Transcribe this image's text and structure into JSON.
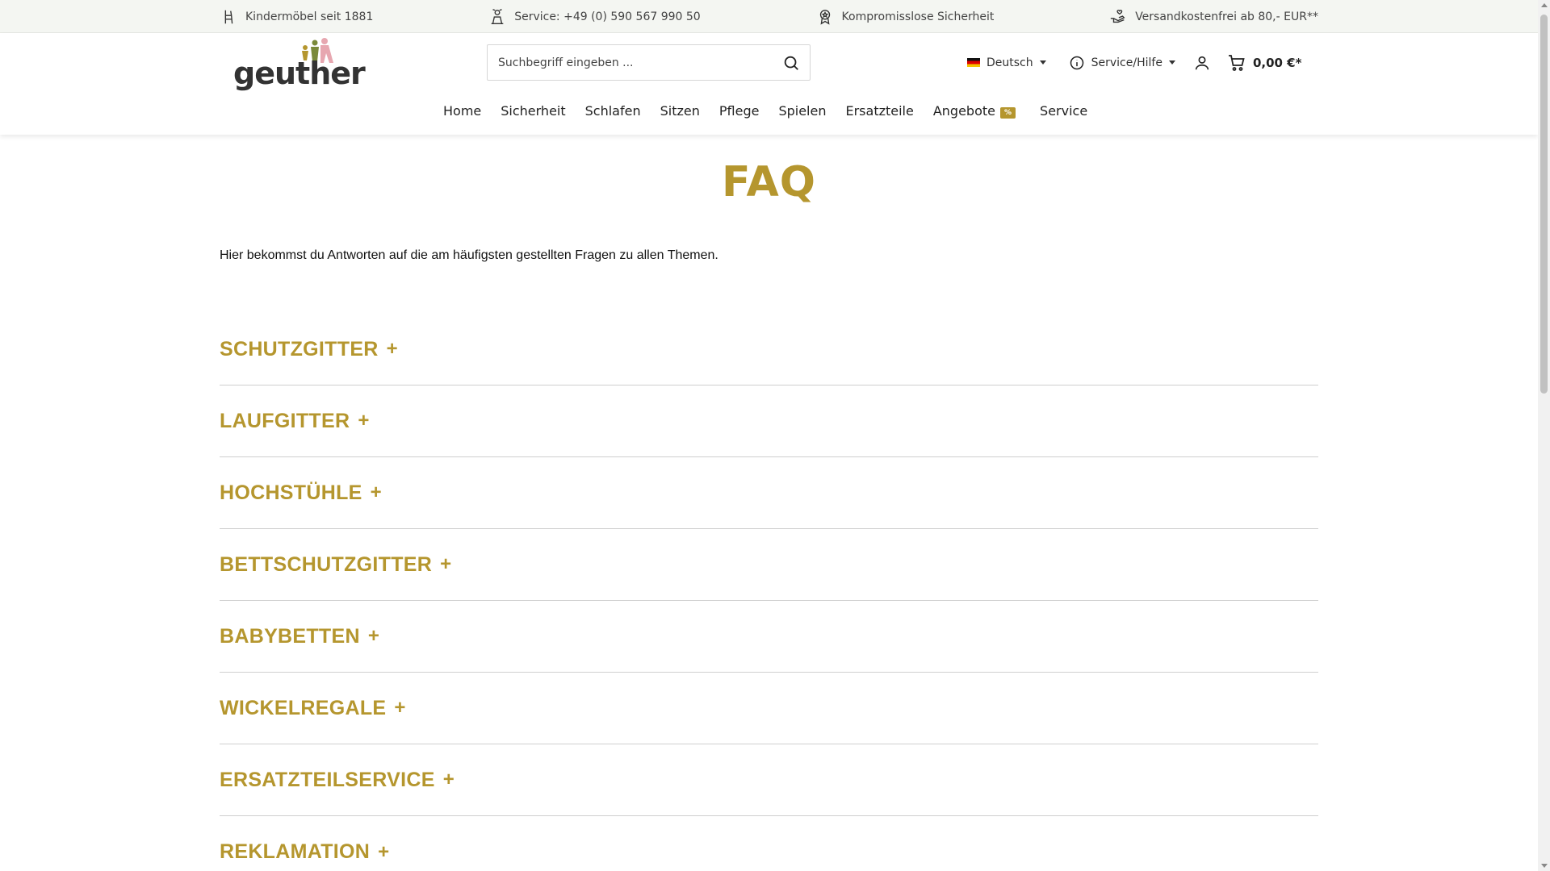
{
  "topbar": {
    "usps": [
      {
        "icon": "highchair-icon",
        "text": "Kindermöbel seit 1881"
      },
      {
        "icon": "service-person-icon",
        "text": "Service: +49 (0) 590 567 990 50"
      },
      {
        "icon": "award-icon",
        "text": "Kompromisslose Sicherheit"
      },
      {
        "icon": "hand-heart-icon",
        "text": "Versandkostenfrei ab 80,- EUR**"
      }
    ]
  },
  "header": {
    "logo_text": "geuther",
    "search_placeholder": "Suchbegriff eingeben ...",
    "language": "Deutsch",
    "service_label": "Service/Hilfe",
    "cart_total": "0,00 €*"
  },
  "nav": {
    "items": [
      "Home",
      "Sicherheit",
      "Schlafen",
      "Sitzen",
      "Pflege",
      "Spielen",
      "Ersatzteile",
      "Angebote",
      "Service"
    ],
    "angebote_badge": "%"
  },
  "main": {
    "title": "FAQ",
    "intro": "Hier bekommst du Antworten auf die am häufigsten gestellten Fragen zu allen Themen.",
    "faq_categories": [
      "SCHUTZGITTER",
      "LAUFGITTER",
      "HOCHSTÜHLE",
      "BETTSCHUTZGITTER",
      "BABYBETTEN",
      "WICKELREGALE",
      "ERSATZTEILSERVICE",
      "REKLAMATION"
    ],
    "expand_symbol": "+"
  },
  "colors": {
    "accent": "#b5962e",
    "topbar_bg": "#f4f6f2",
    "logo_green": "#7a8a3a",
    "logo_pink": "#e7a7b0"
  }
}
